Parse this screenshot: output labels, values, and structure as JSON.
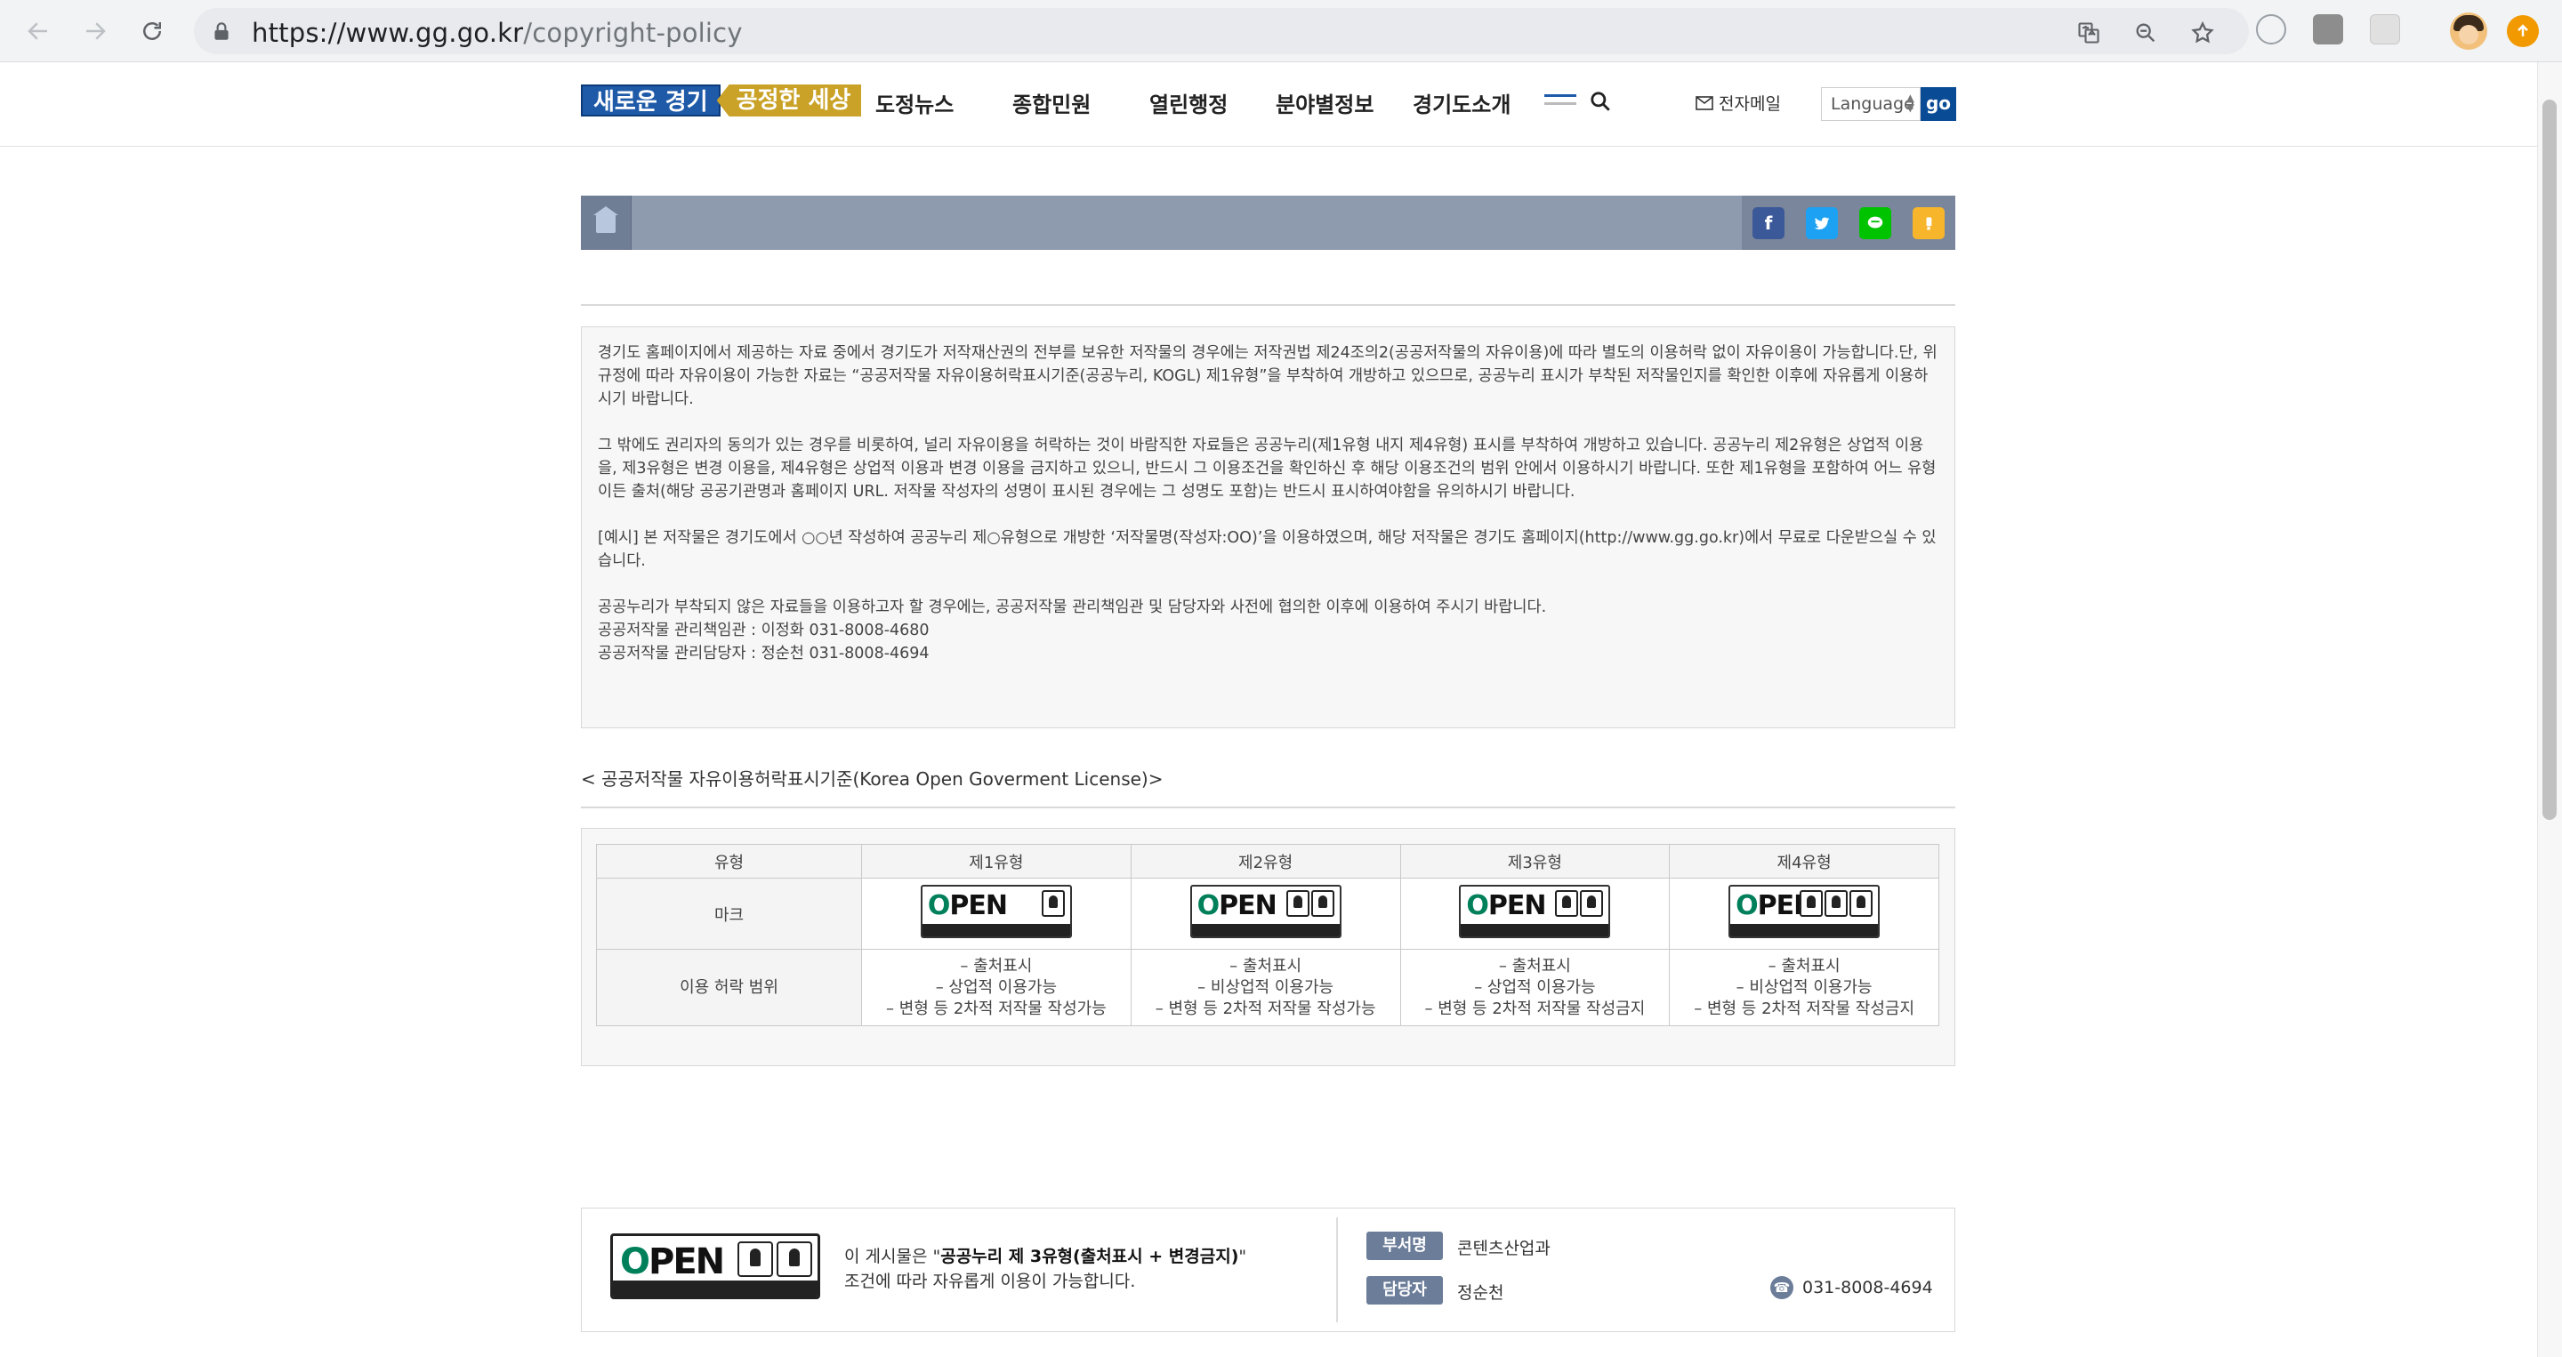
{
  "browser": {
    "url_host": "https://www.gg.go.kr",
    "url_path": "/copyright-policy"
  },
  "header": {
    "logo_part1": "새로운 경기",
    "logo_part2": "공정한 세상",
    "nav": [
      "도정뉴스",
      "종합민원",
      "열린행정",
      "분야별정보",
      "경기도소개"
    ],
    "email_label": "전자메일",
    "language_label": "Language",
    "go_label": "go"
  },
  "notice": {
    "p1": "경기도 홈페이지에서 제공하는 자료 중에서 경기도가 저작재산권의 전부를 보유한 저작물의 경우에는 저작권법 제24조의2(공공저작물의 자유이용)에 따라 별도의 이용허락 없이 자유이용이 가능합니다.단, 위 규정에 따라 자유이용이 가능한 자료는 “공공저작물 자유이용허락표시기준(공공누리, KOGL) 제1유형”을 부착하여 개방하고 있으므로, 공공누리 표시가 부착된 저작물인지를 확인한 이후에 자유롭게 이용하시기 바랍니다.",
    "p2": "그 밖에도 권리자의 동의가 있는 경우를 비롯하여, 널리 자유이용을 허락하는 것이 바람직한 자료들은 공공누리(제1유형 내지 제4유형) 표시를 부착하여 개방하고 있습니다. 공공누리 제2유형은 상업적 이용을, 제3유형은 변경 이용을, 제4유형은 상업적 이용과 변경 이용을 금지하고 있으니, 반드시 그 이용조건을 확인하신 후 해당 이용조건의 범위 안에서 이용하시기 바랍니다. 또한 제1유형을 포함하여 어느 유형이든 출처(해당 공공기관명과 홈페이지 URL. 저작물 작성자의 성명이 표시된 경우에는 그 성명도 포함)는 반드시 표시하여야함을 유의하시기 바랍니다.",
    "p3": "[예시] 본 저작물은 경기도에서 ○○년 작성하여 공공누리 제○유형으로 개방한 ‘저작물명(작성자:OO)’을 이용하였으며, 해당 저작물은 경기도 홈페이지(http://www.gg.go.kr)에서 무료로 다운받으실 수 있습니다.",
    "p4": "공공누리가 부착되지 않은 자료들을 이용하고자 할 경우에는, 공공저작물 관리책임관 및 담당자와 사전에 협의한 이후에 이용하여 주시기 바랍니다.",
    "p5": "공공저작물 관리책임관 : 이정화 031-8008-4680",
    "p6": "공공저작물 관리담당자 : 정순천 031-8008-4694"
  },
  "license": {
    "title": "< 공공저작물 자유이용허락표시기준(Korea Open Goverment License)>",
    "headers": [
      "유형",
      "제1유형",
      "제2유형",
      "제3유형",
      "제4유형"
    ],
    "mark_label": "마크",
    "mark_word": "OPEN",
    "range_label": "이용 허락 범위",
    "ranges": [
      [
        "– 출처표시",
        "– 상업적 이용가능",
        "– 변형 등 2차적 저작물 작성가능"
      ],
      [
        "– 출처표시",
        "– 비상업적 이용가능",
        "– 변형 등 2차적 저작물 작성가능"
      ],
      [
        "– 출처표시",
        "– 상업적 이용가능",
        "– 변형 등 2차적 저작물 작성금지"
      ],
      [
        "– 출처표시",
        "– 비상업적 이용가능",
        "– 변형 등 2차적 저작물 작성금지"
      ]
    ]
  },
  "footer_info": {
    "prefix": "이 게시물은 \"",
    "type_bold": "공공누리 제 3유형(출처표시 + 변경금지)",
    "suffix": "\"",
    "line2": "조건에 따라 자유롭게 이용이 가능합니다.",
    "dept_label": "부서명",
    "dept_value": "콘텐츠산업과",
    "manager_label": "담당자",
    "manager_value": "정순천",
    "phone": "031-8008-4694"
  },
  "colors": {
    "brand_blue": "#1e5aa8",
    "brand_gold": "#c9a227",
    "locbar": "#8e9aae",
    "facebook": "#3b5998",
    "twitter": "#1da1f2",
    "line": "#00c300",
    "kakaostory": "#f7b52b"
  }
}
